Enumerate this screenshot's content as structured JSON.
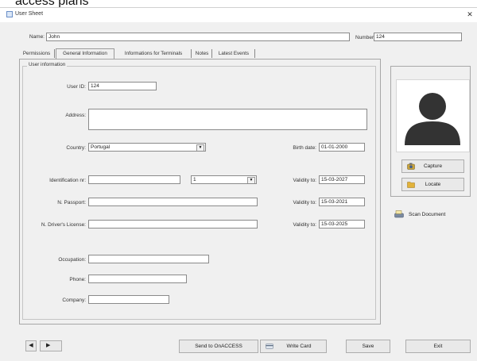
{
  "caption": "access plans",
  "window": {
    "title": "User Sheet",
    "close": "✕"
  },
  "top": {
    "name_label": "Name:",
    "name_value": "John",
    "number_label": "Number:",
    "number_value": "124"
  },
  "tabs": [
    {
      "label": "Permissions"
    },
    {
      "label": "General Information"
    },
    {
      "label": "Informations for Terminals"
    },
    {
      "label": "Notes"
    },
    {
      "label": "Latest Events"
    }
  ],
  "group": {
    "title": "User information"
  },
  "fields": {
    "user_id_label": "User ID:",
    "user_id_value": "124",
    "address_label": "Address:",
    "address_value": "",
    "country_label": "Country:",
    "country_value": "Portugal",
    "birth_label": "Birth date:",
    "birth_value": "01-01-2000",
    "ident_label": "Identification nr:",
    "ident_value": "",
    "ident_type_value": "1",
    "validity1_label": "Validity to:",
    "validity1_value": "15-03-2027",
    "passport_label": "N. Passport:",
    "passport_value": "",
    "validity2_label": "Validity to:",
    "validity2_value": "15-03-2021",
    "license_label": "N. Driver's License:",
    "license_value": "",
    "validity3_label": "Validity to:",
    "validity3_value": "15-03-2025",
    "occupation_label": "Occupation:",
    "occupation_value": "",
    "phone_label": "Phone:",
    "phone_value": "",
    "company_label": "Company:",
    "company_value": ""
  },
  "side": {
    "capture_label": "Capture",
    "locate_label": "Locate",
    "scan_label": "Scan Document"
  },
  "bottom": {
    "prev": "◀",
    "next": "▶",
    "send_label": "Send to OnACCESS",
    "write_label": "Write Card",
    "save_label": "Save",
    "exit_label": "Exit"
  },
  "colors": {
    "avatar": "#333333",
    "frame_border": "#a8a8a8",
    "window_bg": "#f0f0f0"
  }
}
